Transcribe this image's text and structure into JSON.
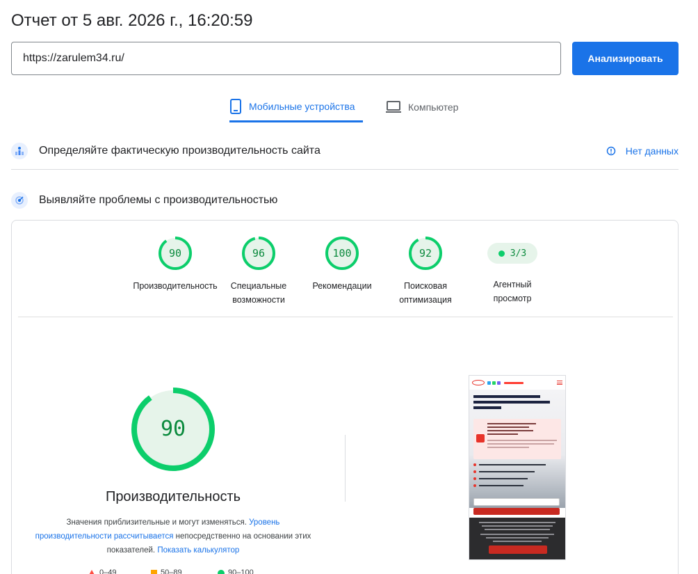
{
  "header": {
    "title": "Отчет от 5 авг. 2026 г., 16:20:59",
    "url_value": "https://zarulem34.ru/",
    "analyze_label": "Анализировать"
  },
  "tabs": [
    {
      "label": "Мобильные устройства",
      "icon": "smartphone-icon",
      "active": true
    },
    {
      "label": "Компьютер",
      "icon": "laptop-icon",
      "active": false
    }
  ],
  "sections": {
    "field_data": {
      "title": "Определяйте фактическую производительность сайта",
      "status": "Нет данных",
      "icon": "field-data-icon"
    },
    "lab_data": {
      "title": "Выявляйте проблемы с производительностью",
      "icon": "lab-data-icon"
    }
  },
  "scores": [
    {
      "value": "90",
      "label": "Производительность",
      "fraction": 0.9
    },
    {
      "value": "96",
      "label_line1": "Специальные",
      "label_line2": "возможности",
      "fraction": 0.96
    },
    {
      "value": "100",
      "label": "Рекомендации",
      "fraction": 1.0
    },
    {
      "value": "92",
      "label_line1": "Поисковая",
      "label_line2": "оптимизация",
      "fraction": 0.92
    }
  ],
  "agent": {
    "value": "3/3",
    "label_line1": "Агентный",
    "label_line2": "просмотр"
  },
  "performance": {
    "score": "90",
    "fraction": 0.9,
    "title": "Производительность",
    "note_part1": "Значения приблизительные и могут изменяться. ",
    "note_link1": "Уровень производительности рассчитывается",
    "note_part2": " непосредственно на основании этих показателей. ",
    "note_link2": "Показать калькулятор"
  },
  "legend": [
    "0–49",
    "50–89",
    "90–100"
  ],
  "colors": {
    "accent": "#1a73e8",
    "good": "#0cce6b",
    "good_text": "#0b8a3d",
    "good_bg": "#e6f4ea",
    "average": "#ffa400",
    "poor": "#ff4e42"
  }
}
